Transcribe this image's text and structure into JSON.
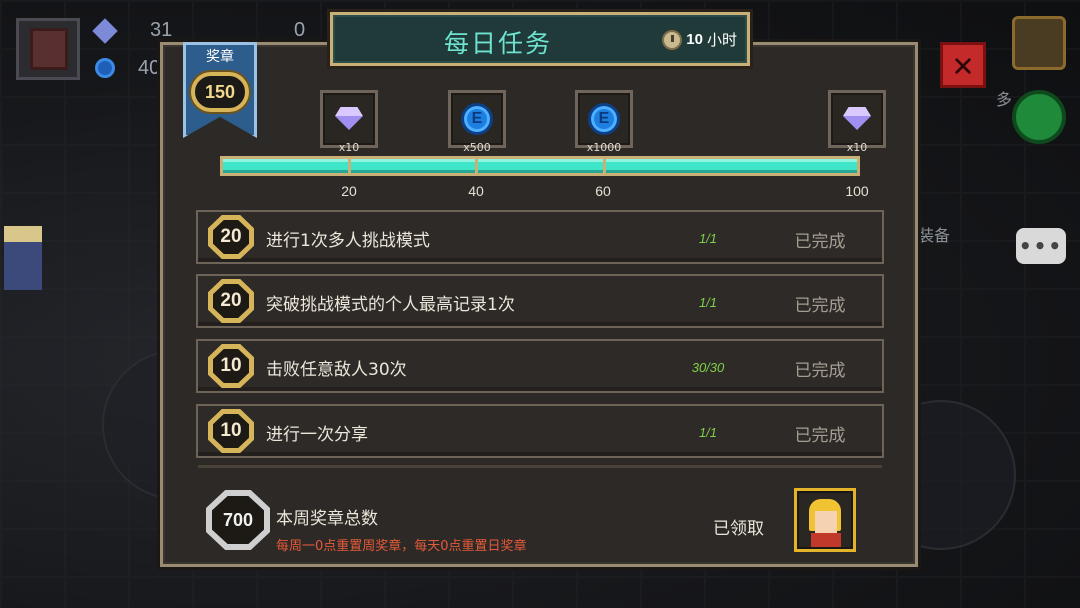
{
  "background": {
    "resources": [
      {
        "icon": "gem-icon",
        "value": "31"
      },
      {
        "icon": "coin-icon",
        "value": "40"
      },
      {
        "icon": "materials-icon",
        "value": "0"
      }
    ],
    "side_labels": {
      "multiplayer": "多",
      "equipment": "装备"
    }
  },
  "dialog": {
    "title": "每日任务",
    "timer": {
      "icon": "clock-icon",
      "value": "10",
      "unit": "小时"
    },
    "ribbon": {
      "label": "奖章",
      "value": "150"
    },
    "rewards": [
      {
        "icon": "gem-icon",
        "qty": "x10"
      },
      {
        "icon": "coin-icon",
        "qty": "x500"
      },
      {
        "icon": "coin-icon",
        "qty": "x1000"
      },
      {
        "icon": "gem-icon",
        "qty": "x10"
      }
    ],
    "progress": {
      "value": 150,
      "max": 100,
      "fill_fraction": 1.0
    },
    "milestones": [
      "20",
      "40",
      "60",
      "100"
    ],
    "tasks": [
      {
        "reward": "20",
        "desc": "进行1次多人挑战模式",
        "progress": "1/1",
        "status": "已完成"
      },
      {
        "reward": "20",
        "desc": "突破挑战模式的个人最高记录1次",
        "progress": "1/1",
        "status": "已完成"
      },
      {
        "reward": "10",
        "desc": "击败任意敌人30次",
        "progress": "30/30",
        "status": "已完成"
      },
      {
        "reward": "10",
        "desc": "进行一次分享",
        "progress": "1/1",
        "status": "已完成"
      }
    ],
    "footer": {
      "total_value": "700",
      "total_label": "本周奖章总数",
      "note": "每周一0点重置周奖章，每天0点重置日奖章",
      "claimed_label": "已领取",
      "portrait": "character-portrait"
    }
  },
  "colors": {
    "accent_teal": "#3fe5c8",
    "gold_border": "#c9b077",
    "complete_green": "#7ed04a",
    "note_red": "#e45a3a"
  }
}
